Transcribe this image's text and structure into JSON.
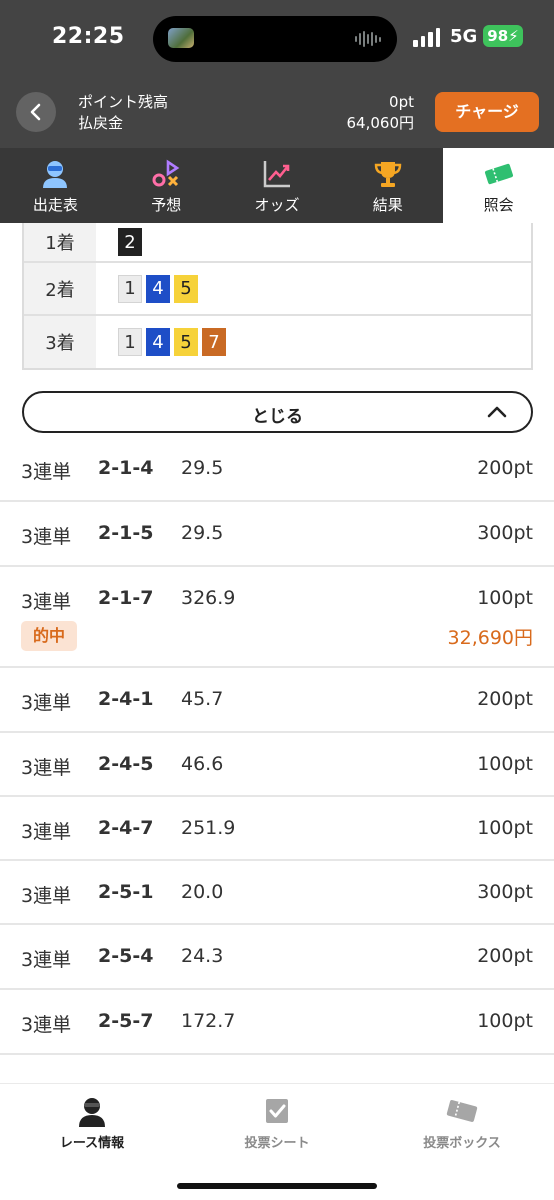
{
  "status": {
    "time": "22:25",
    "network": "5G",
    "battery": "98"
  },
  "header": {
    "point_label": "ポイント残高",
    "refund_label": "払戻金",
    "point_value": "0pt",
    "refund_value": "64,060円",
    "charge_label": "チャージ"
  },
  "tabs": [
    {
      "label": "出走表",
      "icon": "racer-icon"
    },
    {
      "label": "予想",
      "icon": "prediction-icon"
    },
    {
      "label": "オッズ",
      "icon": "odds-chart-icon"
    },
    {
      "label": "結果",
      "icon": "trophy-icon"
    },
    {
      "label": "照会",
      "icon": "ticket-icon"
    }
  ],
  "results": [
    {
      "label": "1着",
      "numbers": [
        "2"
      ]
    },
    {
      "label": "2着",
      "numbers": [
        "1",
        "4",
        "5"
      ]
    },
    {
      "label": "3着",
      "numbers": [
        "1",
        "4",
        "5",
        "7"
      ]
    }
  ],
  "close_label": "とじる",
  "bets": [
    {
      "type": "3連単",
      "combo": "2-1-4",
      "odds": "29.5",
      "amount": "200pt"
    },
    {
      "type": "3連単",
      "combo": "2-1-5",
      "odds": "29.5",
      "amount": "300pt"
    },
    {
      "type": "3連単",
      "combo": "2-1-7",
      "odds": "326.9",
      "amount": "100pt",
      "hit": "的中",
      "payout": "32,690円"
    },
    {
      "type": "3連単",
      "combo": "2-4-1",
      "odds": "45.7",
      "amount": "200pt"
    },
    {
      "type": "3連単",
      "combo": "2-4-5",
      "odds": "46.6",
      "amount": "100pt"
    },
    {
      "type": "3連単",
      "combo": "2-4-7",
      "odds": "251.9",
      "amount": "100pt"
    },
    {
      "type": "3連単",
      "combo": "2-5-1",
      "odds": "20.0",
      "amount": "300pt"
    },
    {
      "type": "3連単",
      "combo": "2-5-4",
      "odds": "24.3",
      "amount": "200pt"
    },
    {
      "type": "3連単",
      "combo": "2-5-7",
      "odds": "172.7",
      "amount": "100pt"
    }
  ],
  "bottom_nav": [
    {
      "label": "レース情報",
      "icon": "race-info-icon"
    },
    {
      "label": "投票シート",
      "icon": "vote-sheet-icon"
    },
    {
      "label": "投票ボックス",
      "icon": "vote-box-icon"
    }
  ],
  "colors": {
    "header_bg": "#444444",
    "accent_orange": "#e47022",
    "hit_text": "#d86a1c",
    "boat_1": "#ececec",
    "boat_2": "#222222",
    "boat_4": "#1e4ec7",
    "boat_5": "#f6d23a",
    "boat_7": "#c96a24"
  }
}
